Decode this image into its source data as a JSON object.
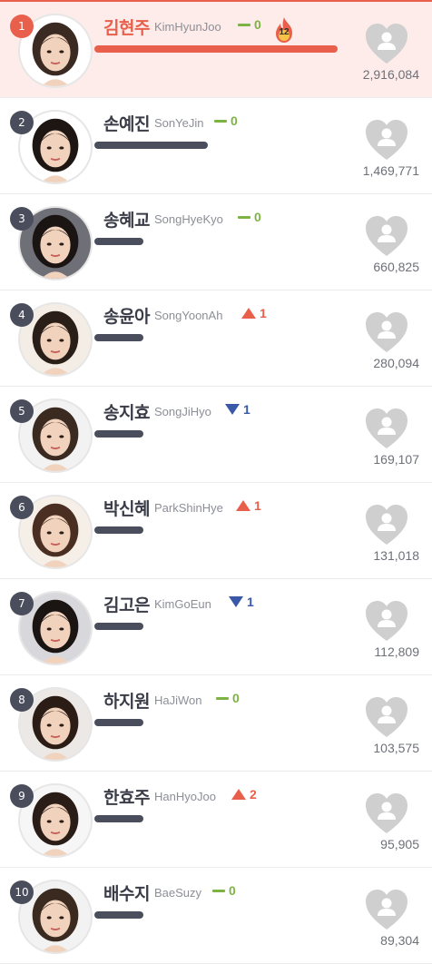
{
  "colors": {
    "accent": "#e8604c",
    "dark": "#4a4d5c",
    "same": "#7cb342",
    "up": "#e8604c",
    "down": "#3a58a8",
    "heart": "#cfcfcf",
    "top_row_bg": "#fdecea"
  },
  "icons": {
    "vote": "heart-person-icon",
    "streak": "flame-icon",
    "photo": "avatar-photo"
  },
  "rankings": [
    {
      "rank": "1",
      "name_ko": "김현주",
      "name_en": "KimHyunJoo",
      "change_type": "same",
      "change": "0",
      "streak": "12",
      "votes": "2,916,084",
      "bar_fraction": 1.0
    },
    {
      "rank": "2",
      "name_ko": "손예진",
      "name_en": "SonYeJin",
      "change_type": "same",
      "change": "0",
      "votes": "1,469,771",
      "bar_fraction": 0.466
    },
    {
      "rank": "3",
      "name_ko": "송혜교",
      "name_en": "SongHyeKyo",
      "change_type": "same",
      "change": "0",
      "votes": "660,825",
      "bar_fraction": 0.2
    },
    {
      "rank": "4",
      "name_ko": "송윤아",
      "name_en": "SongYoonAh",
      "change_type": "up",
      "change": "1",
      "votes": "280,094",
      "bar_fraction": 0.2
    },
    {
      "rank": "5",
      "name_ko": "송지효",
      "name_en": "SongJiHyo",
      "change_type": "down",
      "change": "1",
      "votes": "169,107",
      "bar_fraction": 0.2
    },
    {
      "rank": "6",
      "name_ko": "박신혜",
      "name_en": "ParkShinHye",
      "change_type": "up",
      "change": "1",
      "votes": "131,018",
      "bar_fraction": 0.2
    },
    {
      "rank": "7",
      "name_ko": "김고은",
      "name_en": "KimGoEun",
      "change_type": "down",
      "change": "1",
      "votes": "112,809",
      "bar_fraction": 0.2
    },
    {
      "rank": "8",
      "name_ko": "하지원",
      "name_en": "HaJiWon",
      "change_type": "same",
      "change": "0",
      "votes": "103,575",
      "bar_fraction": 0.2
    },
    {
      "rank": "9",
      "name_ko": "한효주",
      "name_en": "HanHyoJoo",
      "change_type": "up",
      "change": "2",
      "votes": "95,905",
      "bar_fraction": 0.2
    },
    {
      "rank": "10",
      "name_ko": "배수지",
      "name_en": "BaeSuzy",
      "change_type": "same",
      "change": "0",
      "votes": "89,304",
      "bar_fraction": 0.2
    }
  ]
}
